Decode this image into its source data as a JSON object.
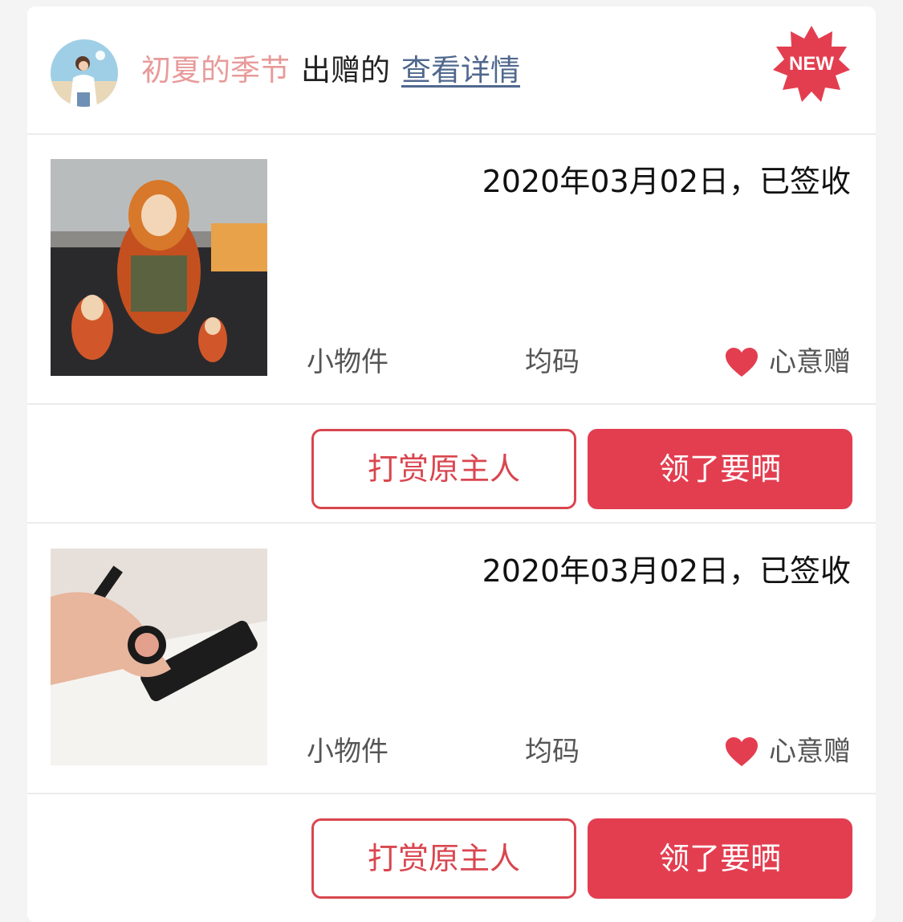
{
  "header": {
    "username": "初夏的季节",
    "verb": "出赠的",
    "details_link": "查看详情",
    "badge": "NEW"
  },
  "items": [
    {
      "date_status": "2020年03月02日，已签收",
      "category": "小物件",
      "size": "均码",
      "gift_type": "心意赠",
      "image": "matryoshka-dolls-photo",
      "reward_button": "打赏原主人",
      "share_button": "领了要晒"
    },
    {
      "date_status": "2020年03月02日，已签收",
      "category": "小物件",
      "size": "均码",
      "gift_type": "心意赠",
      "image": "makeup-compact-photo",
      "reward_button": "打赏原主人",
      "share_button": "领了要晒"
    }
  ],
  "colors": {
    "accent": "#e33e50",
    "username": "#e89a9a",
    "link": "#50688e"
  },
  "icons": [
    "heart-icon",
    "new-starburst-icon"
  ]
}
